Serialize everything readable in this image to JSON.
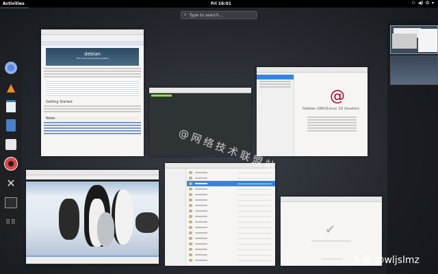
{
  "topbar": {
    "activities": "Activities",
    "clock": "Fri 16:01",
    "icons": [
      "network-icon",
      "volume-icon",
      "power-icon",
      "chevron-down-icon"
    ]
  },
  "search": {
    "placeholder": "Type to search..."
  },
  "dock": [
    "chromium",
    "vlc",
    "libreoffice-impress",
    "text-editor",
    "software",
    "help",
    "tweaks",
    "terminal",
    "show-applications"
  ],
  "windows": {
    "firefox": {
      "brand": "debian",
      "tagline": "The universal operating system",
      "heading1": "Getting Started",
      "heading2": "News"
    },
    "terminal": {},
    "settings": {
      "os_name": "Debian GNU/Linux 10 (buster)"
    },
    "vlc": {},
    "files": {
      "rows": 17,
      "selected_row": 3
    },
    "software": {}
  },
  "watermarks": {
    "center": "@网络技术联盟站",
    "corner": "头条 @wljslmz"
  }
}
